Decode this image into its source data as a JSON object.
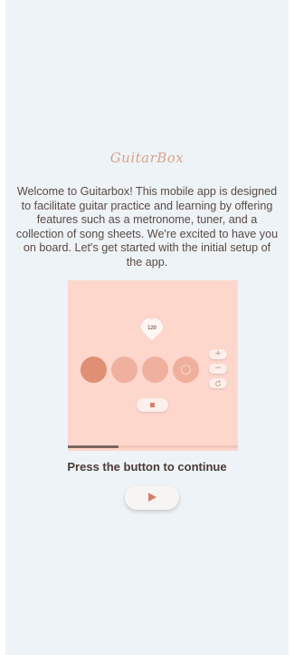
{
  "app": {
    "logo_text": "GuitarBox"
  },
  "intro": {
    "welcome_text": "Welcome to Guitarbox! This mobile app is designed to facilitate guitar practice and learning by offering features such as a metronome, tuner, and a collection of song sheets. We're excited to have you on board. Let's get started with the initial setup of the app."
  },
  "preview": {
    "bpm": "120",
    "beats": 4,
    "active_beat": 1,
    "controls": {
      "plus_label": "+",
      "minus_label": "−",
      "reset_icon": "refresh-icon"
    },
    "stop_icon": "stop-icon",
    "progress": 0.3
  },
  "continue": {
    "caption": "Press the button to continue",
    "play_icon": "play-icon"
  },
  "colors": {
    "background": "#edf3f7",
    "preview_bg": "#fdd6cc",
    "beat_active": "#df8f73",
    "beat_inactive": "#efb09d",
    "accent": "#d77f68",
    "text": "#5b4a45"
  }
}
